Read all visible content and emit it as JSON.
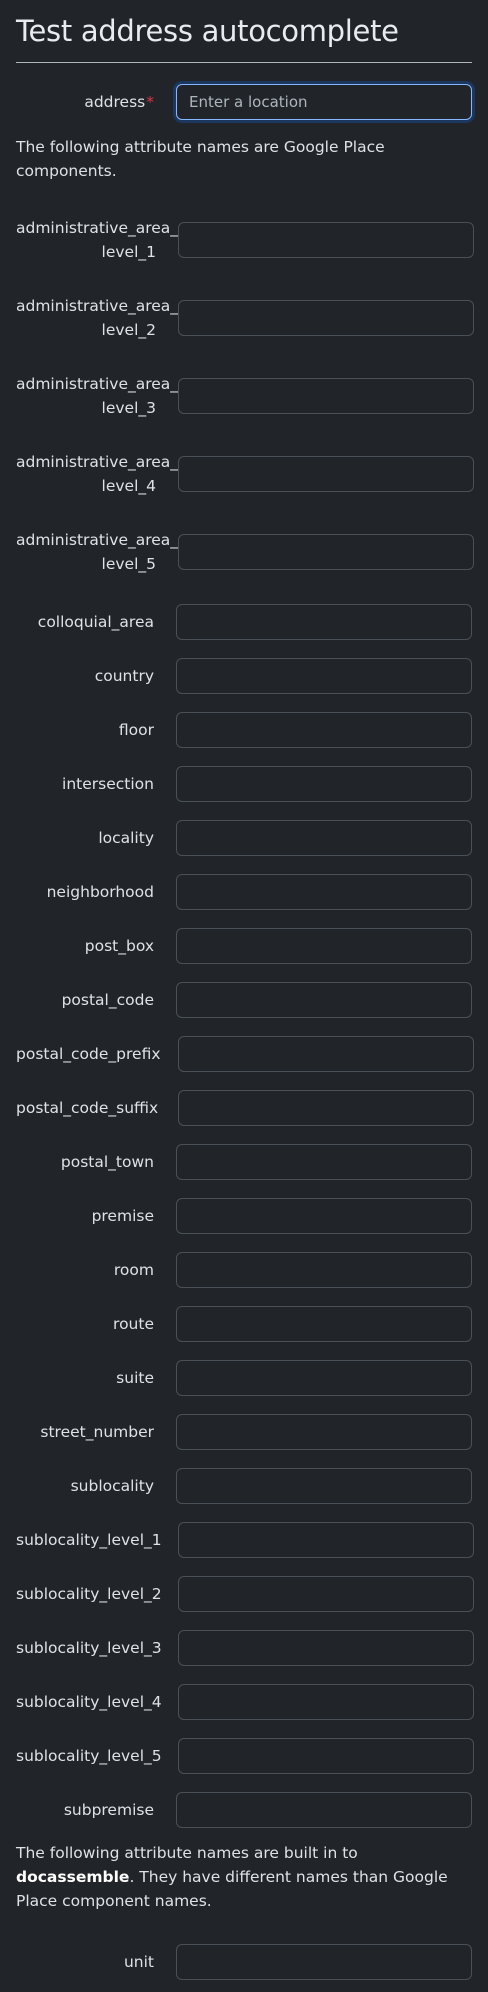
{
  "page": {
    "title": "Test address autocomplete"
  },
  "address": {
    "label": "address",
    "required_marker": "*",
    "placeholder": "Enter a location"
  },
  "notes": {
    "google": "The following attribute names are Google Place components.",
    "builtin_prefix": "The following attribute names are built in to ",
    "builtin_bold": "docassemble",
    "builtin_suffix": ". They have different names than Google Place component names."
  },
  "google_fields": [
    {
      "line1": "administrative_area_",
      "line2": "level_1"
    },
    {
      "line1": "administrative_area_",
      "line2": "level_2"
    },
    {
      "line1": "administrative_area_",
      "line2": "level_3"
    },
    {
      "line1": "administrative_area_",
      "line2": "level_4"
    },
    {
      "line1": "administrative_area_",
      "line2": "level_5"
    },
    {
      "label": "colloquial_area"
    },
    {
      "label": "country"
    },
    {
      "label": "floor"
    },
    {
      "label": "intersection"
    },
    {
      "label": "locality"
    },
    {
      "label": "neighborhood"
    },
    {
      "label": "post_box"
    },
    {
      "label": "postal_code"
    },
    {
      "label": "postal_code_prefix"
    },
    {
      "label": "postal_code_suffix"
    },
    {
      "label": "postal_town"
    },
    {
      "label": "premise"
    },
    {
      "label": "room"
    },
    {
      "label": "route"
    },
    {
      "label": "suite"
    },
    {
      "label": "street_number"
    },
    {
      "label": "sublocality"
    },
    {
      "label": "sublocality_level_1"
    },
    {
      "label": "sublocality_level_2"
    },
    {
      "label": "sublocality_level_3"
    },
    {
      "label": "sublocality_level_4"
    },
    {
      "label": "sublocality_level_5"
    },
    {
      "label": "subpremise"
    }
  ],
  "builtin_fields": [
    {
      "label": "unit"
    }
  ]
}
